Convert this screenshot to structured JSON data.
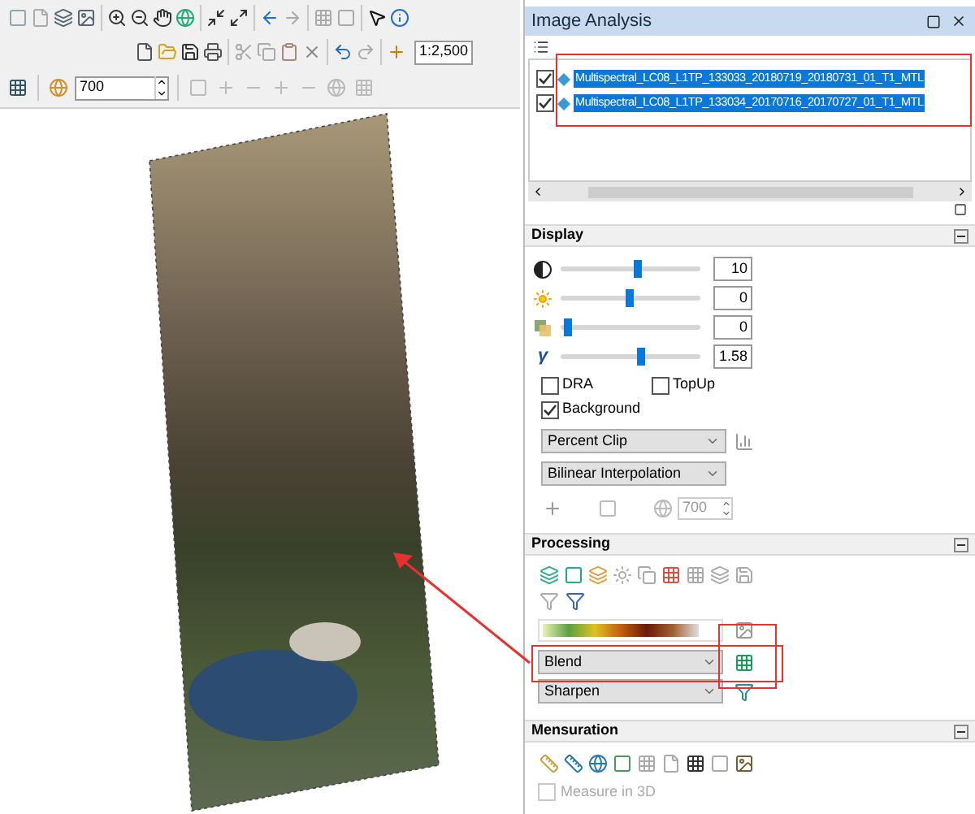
{
  "toolbar": {
    "scale": "1:2,500",
    "elevation": "700"
  },
  "image_analysis": {
    "title": "Image Analysis",
    "layers": [
      {
        "name": "Multispectral_LC08_L1TP_133033_20180719_20180731_01_T1_MTL",
        "checked": true,
        "selected": true
      },
      {
        "name": "Multispectral_LC08_L1TP_133034_20170716_20170727_01_T1_MTL",
        "checked": true,
        "selected": true
      }
    ],
    "display": {
      "title": "Display",
      "sliders": [
        {
          "kind": "contrast",
          "level": 0.55,
          "reading": "10"
        },
        {
          "kind": "brightness",
          "level": 0.49,
          "reading": "0"
        },
        {
          "kind": "transparency",
          "level": 0.02,
          "reading": "0"
        },
        {
          "kind": "gamma",
          "symbol": "γ",
          "level": 0.58,
          "reading": "1.58"
        }
      ],
      "checkboxes": [
        {
          "label": "DRA",
          "checked": false
        },
        {
          "label": "TopUp",
          "checked": false
        },
        {
          "label": "Background",
          "checked": true
        }
      ],
      "stretch": "Percent Clip",
      "resampling": "Bilinear Interpolation",
      "spin": {
        "value": "700",
        "disabled": true
      }
    },
    "processing": {
      "title": "Processing",
      "blend": "Blend",
      "sharpen": "Sharpen"
    },
    "mensuration": {
      "title": "Mensuration",
      "checkbox": {
        "label": "Measure in 3D",
        "checked": false,
        "disabled": true
      }
    }
  }
}
